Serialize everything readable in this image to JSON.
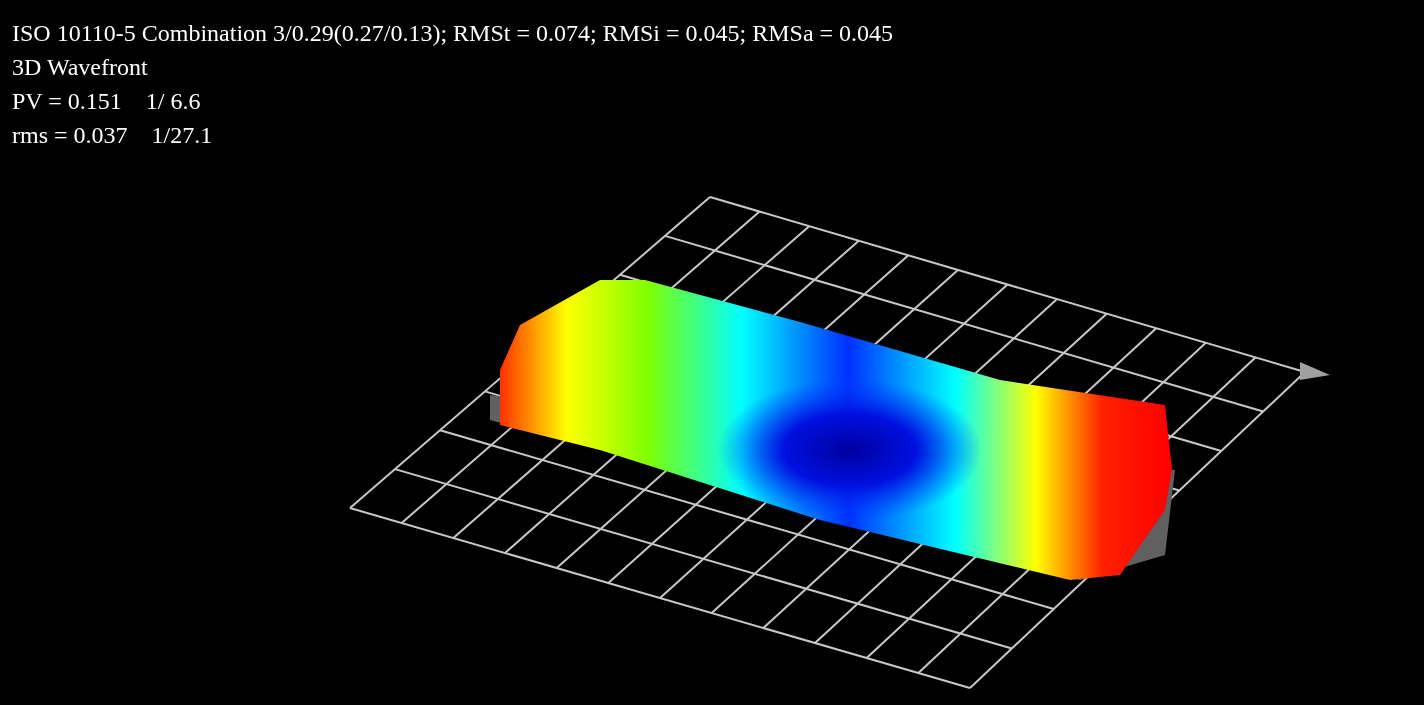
{
  "info_lines": [
    "ISO 10110-5 Combination 3/0.29(0.27/0.13); RMSt = 0.074; RMSi = 0.045; RMSa = 0.045",
    "3D Wavefront",
    "PV = 0.151    1/ 6.6",
    "rms = 0.037    1/27.1"
  ]
}
